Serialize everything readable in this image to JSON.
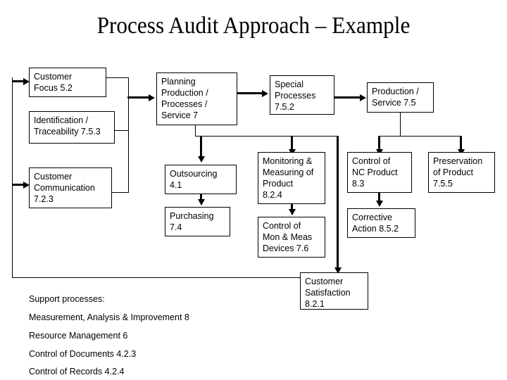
{
  "title": "Process Audit Approach – Example",
  "diagram": {
    "boxes": [
      {
        "id": "customer-focus",
        "label": "Customer\nFocus 5.2"
      },
      {
        "id": "identification",
        "label": "Identification /\nTraceability 7.5.3"
      },
      {
        "id": "customer-communication",
        "label": "Customer\nCommunication\n7.2.3"
      },
      {
        "id": "planning",
        "label": "Planning\nProduction /\nProcesses /\nService 7"
      },
      {
        "id": "special-processes",
        "label": "Special\nProcesses\n7.5.2"
      },
      {
        "id": "production-service",
        "label": "Production /\nService 7.5"
      },
      {
        "id": "outsourcing",
        "label": "Outsourcing\n4.1"
      },
      {
        "id": "purchasing",
        "label": "Purchasing\n7.4"
      },
      {
        "id": "monitoring-measuring",
        "label": "Monitoring &\nMeasuring of\nProduct\n8.2.4"
      },
      {
        "id": "control-mon-meas",
        "label": "Control of\nMon & Meas\nDevices 7.6"
      },
      {
        "id": "control-nc-product",
        "label": "Control of\nNC Product\n8.3"
      },
      {
        "id": "corrective-action",
        "label": "Corrective\nAction 8.5.2"
      },
      {
        "id": "preservation",
        "label": "Preservation\nof Product\n7.5.5"
      },
      {
        "id": "customer-satisfaction",
        "label": "Customer\nSatisfaction\n8.2.1"
      }
    ]
  },
  "support": {
    "heading": "Support processes:",
    "items": [
      "Measurement, Analysis & Improvement 8",
      "Resource Management 6",
      "Control of Documents 4.2.3",
      "Control of Records 4.2.4"
    ]
  },
  "colors": {
    "text": "#000000",
    "background": "#ffffff",
    "stroke": "#000000"
  }
}
